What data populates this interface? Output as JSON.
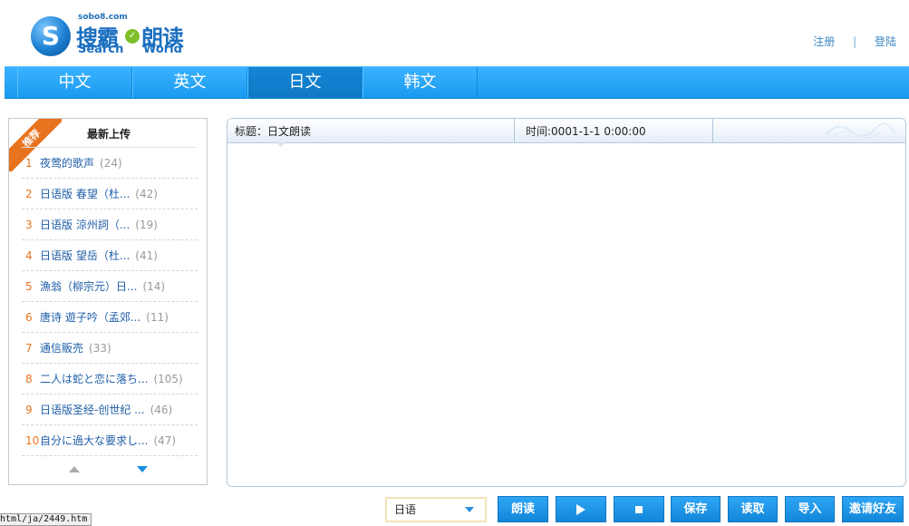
{
  "logo": {
    "domain": "sobo8.com",
    "cn_part1": "搜霸",
    "cn_part2": "朗读",
    "en_part1": "Search",
    "en_part2": "World"
  },
  "toplinks": {
    "register": "注册",
    "separator": "|",
    "login": "登陆"
  },
  "nav": {
    "tabs": [
      "中文",
      "英文",
      "日文",
      "韩文"
    ],
    "active": "日文"
  },
  "sidebar": {
    "badge": "推荐",
    "title": "最新上传",
    "items": [
      {
        "num": "1",
        "name": "夜莺的歌声",
        "count": "(24)"
      },
      {
        "num": "2",
        "name": "日语版 春望（杜...",
        "count": "(42)"
      },
      {
        "num": "3",
        "name": "日语版 涼州詞（...",
        "count": "(19)"
      },
      {
        "num": "4",
        "name": "日语版 望岳（杜...",
        "count": "(41)"
      },
      {
        "num": "5",
        "name": "漁翁（柳宗元）日...",
        "count": "(14)"
      },
      {
        "num": "6",
        "name": "唐诗 遊子吟（孟郊...",
        "count": "(11)"
      },
      {
        "num": "7",
        "name": "通信販売",
        "count": "(33)"
      },
      {
        "num": "8",
        "name": "二人は蛇と恋に落ち...",
        "count": "(105)"
      },
      {
        "num": "9",
        "name": "日语版圣经-创世纪 ...",
        "count": "(46)"
      },
      {
        "num": "10",
        "name": "自分に過大な要求し...",
        "count": "(47)"
      }
    ]
  },
  "main": {
    "title_label": "标题：",
    "title_value": "日文朗读",
    "time_label": "时间:",
    "time_value": "0001-1-1 0:00:00",
    "content": ""
  },
  "controls": {
    "language": "日语",
    "read": "朗读",
    "save": "保存",
    "load": "读取",
    "import": "导入",
    "invite": "邀请好友"
  },
  "statusbar": {
    "url": "html/ja/2449.htm"
  }
}
